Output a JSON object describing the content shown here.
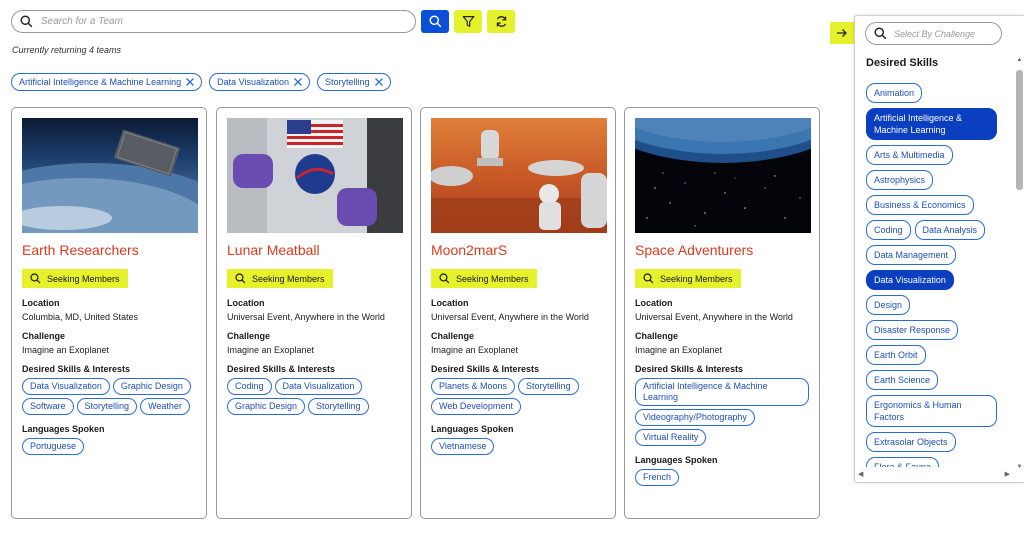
{
  "search": {
    "placeholder": "Search for a Team"
  },
  "status": {
    "returning_text": "Currently returning 4 teams"
  },
  "active_filters": [
    "Artificial Intelligence & Machine Learning",
    "Data Visualization",
    "Storytelling"
  ],
  "labels": {
    "seeking": "Seeking Members",
    "location": "Location",
    "challenge": "Challenge",
    "skills": "Desired Skills & Interests",
    "languages": "Languages Spoken"
  },
  "teams": [
    {
      "name": "Earth Researchers",
      "location": "Columbia, MD, United States",
      "challenge": "Imagine an Exoplanet",
      "skills": [
        "Data Visualization",
        "Graphic Design",
        "Software",
        "Storytelling",
        "Weather"
      ],
      "languages": [
        "Portuguese"
      ]
    },
    {
      "name": "Lunar Meatball",
      "location": "Universal Event, Anywhere in the World",
      "challenge": "Imagine an Exoplanet",
      "skills": [
        "Coding",
        "Data Visualization",
        "Graphic Design",
        "Storytelling"
      ],
      "languages": []
    },
    {
      "name": "Moon2marS",
      "location": "Universal Event, Anywhere in the World",
      "challenge": "Imagine an Exoplanet",
      "skills": [
        "Planets & Moons",
        "Storytelling",
        "Web Development"
      ],
      "languages": [
        "Vietnamese"
      ]
    },
    {
      "name": "Space Adventurers",
      "location": "Universal Event, Anywhere in the World",
      "challenge": "Imagine an Exoplanet",
      "skills": [
        "Artificial Intelligence & Machine Learning",
        "Videography/Photography",
        "Virtual Reality"
      ],
      "languages": [
        "French"
      ]
    }
  ],
  "panel": {
    "placeholder": "Select By Challenge",
    "heading": "Desired Skills",
    "skills": [
      {
        "label": "Animation",
        "active": false
      },
      {
        "label": "Artificial Intelligence & Machine Learning",
        "active": true
      },
      {
        "label": "Arts & Multimedia",
        "active": false
      },
      {
        "label": "Astrophysics",
        "active": false
      },
      {
        "label": "Business & Economics",
        "active": false
      },
      {
        "label": "Coding",
        "active": false
      },
      {
        "label": "Data Analysis",
        "active": false
      },
      {
        "label": "Data Management",
        "active": false
      },
      {
        "label": "Data Visualization",
        "active": true
      },
      {
        "label": "Design",
        "active": false
      },
      {
        "label": "Disaster Response",
        "active": false
      },
      {
        "label": "Earth Orbit",
        "active": false
      },
      {
        "label": "Earth Science",
        "active": false
      },
      {
        "label": "Ergonomics & Human Factors",
        "active": false
      },
      {
        "label": "Extrasolar Objects",
        "active": false
      },
      {
        "label": "Flora & Fauna",
        "active": false
      }
    ]
  },
  "colors": {
    "accent_blue": "#0b4fd6",
    "accent_yellow": "#e4f12b",
    "title_red": "#d83a1f"
  }
}
